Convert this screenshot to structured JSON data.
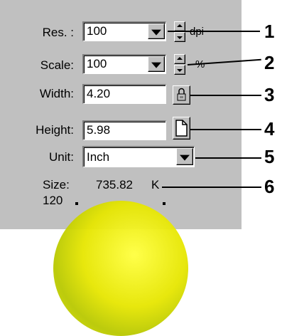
{
  "resolution": {
    "label": "Res. :",
    "value": "100",
    "unit": "dpi"
  },
  "scale": {
    "label": "Scale:",
    "value": "100",
    "unit": "%"
  },
  "width": {
    "label": "Width:",
    "value": "4.20"
  },
  "height": {
    "label": "Height:",
    "value": "5.98"
  },
  "unit": {
    "label": "Unit:",
    "value": "Inch"
  },
  "size": {
    "label": "Size:",
    "value": "735.82",
    "unit": "K"
  },
  "preview": {
    "value": "120"
  },
  "callouts": [
    "1",
    "2",
    "3",
    "4",
    "5",
    "6"
  ],
  "icons": {
    "lock": "lock-icon",
    "page": "page-icon",
    "dropdown": "chevron-down-icon"
  },
  "colors": {
    "panel": "#c0c0c0",
    "preview": "#e6e600"
  }
}
